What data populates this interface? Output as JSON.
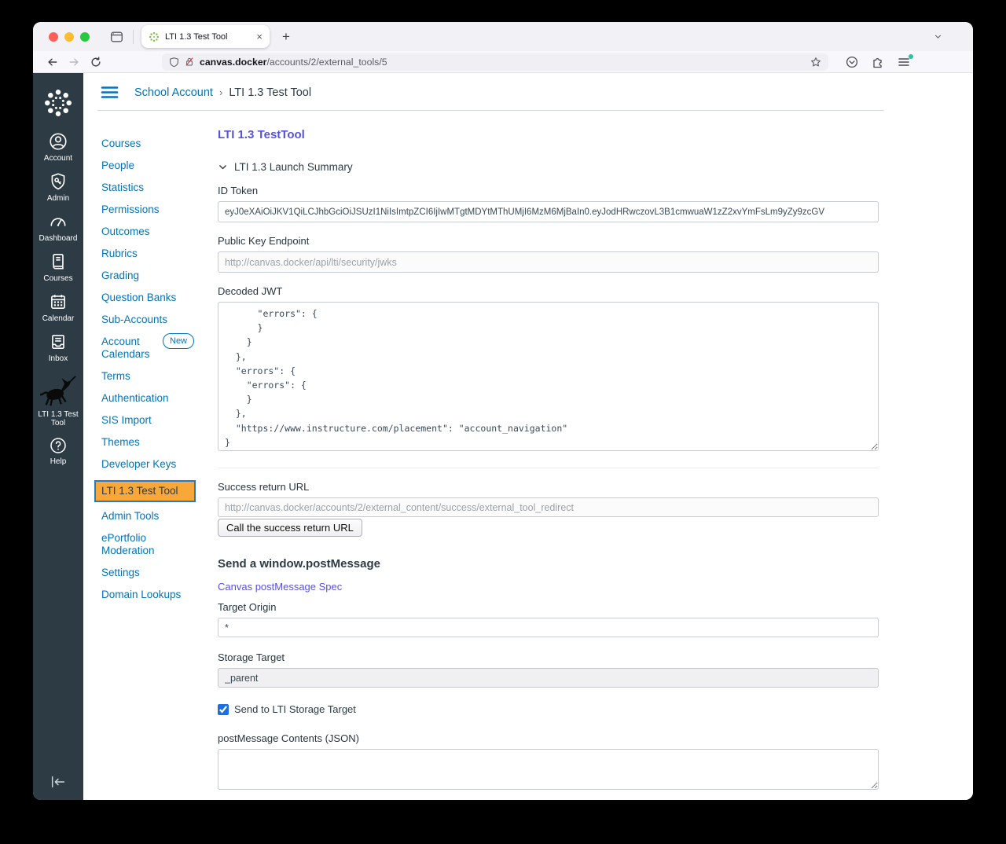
{
  "browser": {
    "tab_title": "LTI 1.3 Test Tool",
    "tab_close": "×",
    "new_tab": "+",
    "url": {
      "host": "canvas.docker",
      "path": "/accounts/2/external_tools/5"
    }
  },
  "sidebar": {
    "items": [
      {
        "label": "Account"
      },
      {
        "label": "Admin"
      },
      {
        "label": "Dashboard"
      },
      {
        "label": "Courses"
      },
      {
        "label": "Calendar"
      },
      {
        "label": "Inbox"
      },
      {
        "label": "LTI 1.3 Test Tool"
      },
      {
        "label": "Help"
      }
    ]
  },
  "breadcrumb": {
    "root": "School Account",
    "separator": "›",
    "current": "LTI 1.3 Test Tool"
  },
  "subnav": {
    "items": [
      {
        "label": "Courses"
      },
      {
        "label": "People"
      },
      {
        "label": "Statistics"
      },
      {
        "label": "Permissions"
      },
      {
        "label": "Outcomes"
      },
      {
        "label": "Rubrics"
      },
      {
        "label": "Grading"
      },
      {
        "label": "Question Banks"
      },
      {
        "label": "Sub-Accounts"
      },
      {
        "label": "Account Calendars",
        "badge": "New"
      },
      {
        "label": "Terms"
      },
      {
        "label": "Authentication"
      },
      {
        "label": "SIS Import"
      },
      {
        "label": "Themes"
      },
      {
        "label": "Developer Keys"
      },
      {
        "label": "LTI 1.3 Test Tool",
        "active": true
      },
      {
        "label": "Admin Tools"
      },
      {
        "label": "ePortfolio Moderation"
      },
      {
        "label": "Settings"
      },
      {
        "label": "Domain Lookups"
      }
    ]
  },
  "content": {
    "title": "LTI 1.3 TestTool",
    "summary_toggle": "LTI 1.3 Launch Summary",
    "id_token": {
      "label": "ID Token",
      "value": "eyJ0eXAiOiJKV1QiLCJhbGciOiJSUzI1NiIsImtpZCI6IjIwMTgtMDYtMThUMjI6MzM6MjBaIn0.eyJodHRwczovL3B1cmwuaW1zZ2xvYmFsLm9yZy9zcGV"
    },
    "public_key": {
      "label": "Public Key Endpoint",
      "value": "http://canvas.docker/api/lti/security/jwks"
    },
    "decoded_jwt": {
      "label": "Decoded JWT",
      "lines": [
        "      \"errors\": {",
        "      }",
        "    }",
        "  },",
        "  \"errors\": {",
        "    \"errors\": {",
        "    }",
        "  },",
        "  \"https://www.instructure.com/placement\": \"account_navigation\"",
        "}"
      ]
    },
    "success_url": {
      "label": "Success return URL",
      "value": "http://canvas.docker/accounts/2/external_content/success/external_tool_redirect",
      "button": "Call the success return URL"
    },
    "post_message": {
      "heading": "Send a window.postMessage",
      "spec_link": "Canvas postMessage Spec",
      "target_origin_label": "Target Origin",
      "target_origin_value": "*",
      "storage_target_label": "Storage Target",
      "storage_target_value": "_parent",
      "checkbox_label": "Send to LTI Storage Target",
      "contents_label": "postMessage Contents (JSON)"
    }
  },
  "colors": {
    "sidebar_bg": "#2D3B45",
    "canvas_link_blue": "#0374B5",
    "tool_purple": "#5753D8",
    "active_highlight_orange": "#F8A839",
    "highlight_border_blue": "#2E76BE",
    "traffic_red": "#FF5F57",
    "traffic_yellow": "#FEBC2E",
    "traffic_green": "#28C840",
    "checkbox_blue": "#1B6FE0",
    "favicon_green": "#7FBF3F"
  }
}
